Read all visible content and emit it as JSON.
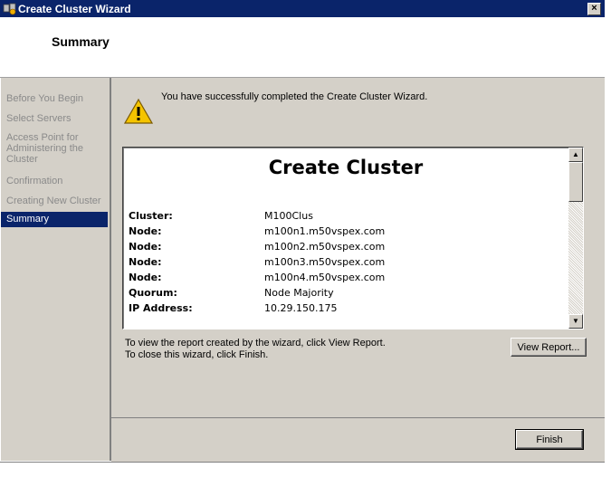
{
  "window": {
    "title": "Create Cluster Wizard",
    "close_glyph": "×"
  },
  "header": {
    "title": "Summary"
  },
  "sidebar": {
    "items": [
      {
        "label": "Before You Begin",
        "active": false
      },
      {
        "label": "Select Servers",
        "active": false
      },
      {
        "label": "Access Point for Administering the Cluster",
        "active": false
      },
      {
        "label": "Confirmation",
        "active": false
      },
      {
        "label": "Creating New Cluster",
        "active": false
      },
      {
        "label": "Summary",
        "active": true
      }
    ]
  },
  "main": {
    "icon": "warning-icon",
    "message": "You have successfully completed the Create Cluster Wizard.",
    "report": {
      "title": "Create Cluster",
      "rows": [
        {
          "key": "Cluster:",
          "value": "M100Clus"
        },
        {
          "key": "Node:",
          "value": "m100n1.m50vspex.com"
        },
        {
          "key": "Node:",
          "value": "m100n2.m50vspex.com"
        },
        {
          "key": "Node:",
          "value": "m100n3.m50vspex.com"
        },
        {
          "key": "Node:",
          "value": "m100n4.m50vspex.com"
        },
        {
          "key": "Quorum:",
          "value": "Node Majority"
        },
        {
          "key": "IP Address:",
          "value": "10.29.150.175"
        }
      ]
    },
    "info_line1": "To view the report created by the wizard, click View Report.",
    "info_line2": "To close this wizard, click Finish.",
    "view_report_label": "View Report..."
  },
  "footer": {
    "finish_label": "Finish"
  },
  "colors": {
    "titlebar": "#0a246a",
    "panel": "#d4d0c8",
    "selection": "#0a246a"
  }
}
